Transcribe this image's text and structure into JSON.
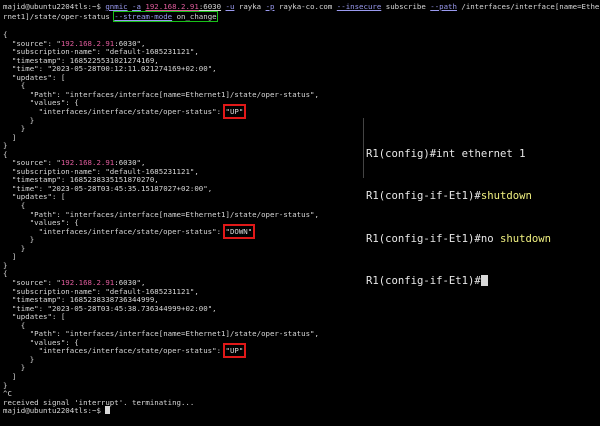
{
  "terminal": {
    "prompt": "majid@ubuntu2204tls:~$ ",
    "command": {
      "bin": "gnmic",
      "a_flag": "-a",
      "address_ip": "192.168.2.91",
      "address_port": ":6030",
      "u_flag": "-u",
      "user": "rayka",
      "p_flag": "-p",
      "password": "rayka-co.com",
      "insecure_flag": "--insecure",
      "subcommand": "subscribe",
      "path_flag": "--path",
      "path_part1": "/interfaces/interface[name=Ethe",
      "path_part2": "rnet1]/state/oper-status",
      "stream_flag": "--stream-mode",
      "stream_value": "on_change"
    },
    "events": [
      {
        "source_ip": "192.168.2.91",
        "source_port": ":6030",
        "subscription_name": "default-1685231121",
        "timestamp": "1685225531021274169",
        "time": "2023-05-28T00:12:11.021274169+02:00",
        "path": "interfaces/interface[name=Ethernet1]/state/oper-status",
        "value_key": "interfaces/interface/state/oper-status",
        "value": "UP"
      },
      {
        "source_ip": "192.168.2.91",
        "source_port": ":6030",
        "subscription_name": "default-1685231121",
        "timestamp": "1685238335151870270",
        "time": "2023-05-28T03:45:35.15187027+02:00",
        "path": "interfaces/interface[name=Ethernet1]/state/oper-status",
        "value_key": "interfaces/interface/state/oper-status",
        "value": "DOWN"
      },
      {
        "source_ip": "192.168.2.91",
        "source_port": ":6030",
        "subscription_name": "default-1685231121",
        "timestamp": "1685238338736344999",
        "time": "2023-05-28T03:45:38.736344999+02:00",
        "path": "interfaces/interface[name=Ethernet1]/state/oper-status",
        "value_key": "interfaces/interface/state/oper-status",
        "value": "UP"
      }
    ],
    "interrupt": "^C",
    "signal_message": "received signal 'interrupt'. terminating...",
    "final_prompt": "majid@ubuntu2204tls:~$ "
  },
  "router": {
    "line1_prompt": "R1(config)#",
    "line1_cmd": "int ethernet 1",
    "line2_prompt": "R1(config-if-Et1)#",
    "line2_cmd": "shutdown",
    "line3_prompt": "R1(config-if-Et1)#",
    "line3_cmd_no": "no ",
    "line3_cmd": "shutdown",
    "line4_prompt": "R1(config-if-Et1)#"
  }
}
